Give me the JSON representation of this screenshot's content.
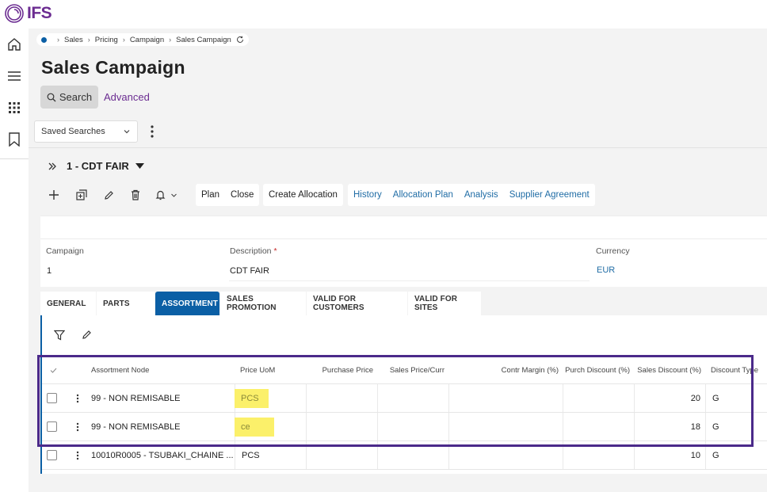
{
  "app": {
    "logo_text": "IFS",
    "brand_color": "#6b2c91",
    "accent_color": "#0b5fa5"
  },
  "sidenav": {
    "items": [
      "home-icon",
      "menu-icon",
      "apps-grid-icon",
      "bookmark-icon"
    ]
  },
  "breadcrumb": {
    "items": [
      "Sales",
      "Pricing",
      "Campaign",
      "Sales Campaign"
    ]
  },
  "page": {
    "title": "Sales Campaign",
    "search_label": "Search",
    "advanced_label": "Advanced",
    "saved_searches_label": "Saved Searches"
  },
  "record": {
    "title": "1 - CDT FAIR"
  },
  "commands": {
    "group1": [
      "Plan",
      "Close"
    ],
    "group2": [
      "Create Allocation"
    ],
    "group3": [
      "History",
      "Allocation Plan",
      "Analysis",
      "Supplier Agreement"
    ]
  },
  "detail": {
    "campaign_label": "Campaign",
    "campaign_value": "1",
    "description_label": "Description",
    "description_required": "*",
    "description_value": "CDT FAIR",
    "currency_label": "Currency",
    "currency_value": "EUR"
  },
  "tabs": [
    "GENERAL",
    "PARTS",
    "ASSORTMENT",
    "SALES PROMOTION",
    "VALID FOR CUSTOMERS",
    "VALID FOR SITES"
  ],
  "active_tab": "ASSORTMENT",
  "table": {
    "columns": {
      "assortment_node": "Assortment Node",
      "price_uom": "Price UoM",
      "purchase_price": "Purchase Price",
      "sales_price_curr": "Sales Price/Curr",
      "contr_margin": "Contr Margin (%)",
      "purch_discount": "Purch Discount (%)",
      "sales_discount": "Sales Discount (%)",
      "discount_type": "Discount Type"
    },
    "rows": [
      {
        "node": "99 - NON REMISABLE",
        "uom": "PCS",
        "sales_discount": "20",
        "discount_type": "G"
      },
      {
        "node": "99 - NON REMISABLE",
        "uom": "ce",
        "sales_discount": "18",
        "discount_type": "G"
      },
      {
        "node": "10010R0005 - TSUBAKI_CHAINE ...",
        "uom": "PCS",
        "sales_discount": "10",
        "discount_type": "G"
      }
    ]
  },
  "highlight_color": "#fbf06a",
  "selection_color": "#4b2a8a"
}
